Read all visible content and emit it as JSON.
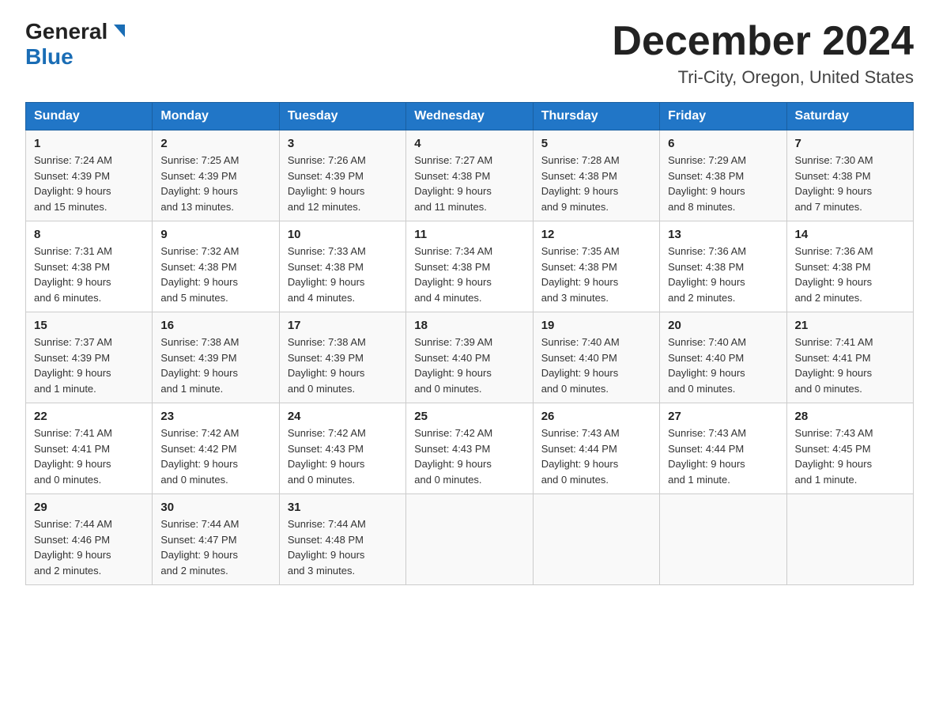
{
  "header": {
    "logo_general": "General",
    "logo_blue": "Blue",
    "month_title": "December 2024",
    "location": "Tri-City, Oregon, United States"
  },
  "days_of_week": [
    "Sunday",
    "Monday",
    "Tuesday",
    "Wednesday",
    "Thursday",
    "Friday",
    "Saturday"
  ],
  "weeks": [
    [
      {
        "day": "1",
        "sunrise": "7:24 AM",
        "sunset": "4:39 PM",
        "daylight": "9 hours and 15 minutes."
      },
      {
        "day": "2",
        "sunrise": "7:25 AM",
        "sunset": "4:39 PM",
        "daylight": "9 hours and 13 minutes."
      },
      {
        "day": "3",
        "sunrise": "7:26 AM",
        "sunset": "4:39 PM",
        "daylight": "9 hours and 12 minutes."
      },
      {
        "day": "4",
        "sunrise": "7:27 AM",
        "sunset": "4:38 PM",
        "daylight": "9 hours and 11 minutes."
      },
      {
        "day": "5",
        "sunrise": "7:28 AM",
        "sunset": "4:38 PM",
        "daylight": "9 hours and 9 minutes."
      },
      {
        "day": "6",
        "sunrise": "7:29 AM",
        "sunset": "4:38 PM",
        "daylight": "9 hours and 8 minutes."
      },
      {
        "day": "7",
        "sunrise": "7:30 AM",
        "sunset": "4:38 PM",
        "daylight": "9 hours and 7 minutes."
      }
    ],
    [
      {
        "day": "8",
        "sunrise": "7:31 AM",
        "sunset": "4:38 PM",
        "daylight": "9 hours and 6 minutes."
      },
      {
        "day": "9",
        "sunrise": "7:32 AM",
        "sunset": "4:38 PM",
        "daylight": "9 hours and 5 minutes."
      },
      {
        "day": "10",
        "sunrise": "7:33 AM",
        "sunset": "4:38 PM",
        "daylight": "9 hours and 4 minutes."
      },
      {
        "day": "11",
        "sunrise": "7:34 AM",
        "sunset": "4:38 PM",
        "daylight": "9 hours and 4 minutes."
      },
      {
        "day": "12",
        "sunrise": "7:35 AM",
        "sunset": "4:38 PM",
        "daylight": "9 hours and 3 minutes."
      },
      {
        "day": "13",
        "sunrise": "7:36 AM",
        "sunset": "4:38 PM",
        "daylight": "9 hours and 2 minutes."
      },
      {
        "day": "14",
        "sunrise": "7:36 AM",
        "sunset": "4:38 PM",
        "daylight": "9 hours and 2 minutes."
      }
    ],
    [
      {
        "day": "15",
        "sunrise": "7:37 AM",
        "sunset": "4:39 PM",
        "daylight": "9 hours and 1 minute."
      },
      {
        "day": "16",
        "sunrise": "7:38 AM",
        "sunset": "4:39 PM",
        "daylight": "9 hours and 1 minute."
      },
      {
        "day": "17",
        "sunrise": "7:38 AM",
        "sunset": "4:39 PM",
        "daylight": "9 hours and 0 minutes."
      },
      {
        "day": "18",
        "sunrise": "7:39 AM",
        "sunset": "4:40 PM",
        "daylight": "9 hours and 0 minutes."
      },
      {
        "day": "19",
        "sunrise": "7:40 AM",
        "sunset": "4:40 PM",
        "daylight": "9 hours and 0 minutes."
      },
      {
        "day": "20",
        "sunrise": "7:40 AM",
        "sunset": "4:40 PM",
        "daylight": "9 hours and 0 minutes."
      },
      {
        "day": "21",
        "sunrise": "7:41 AM",
        "sunset": "4:41 PM",
        "daylight": "9 hours and 0 minutes."
      }
    ],
    [
      {
        "day": "22",
        "sunrise": "7:41 AM",
        "sunset": "4:41 PM",
        "daylight": "9 hours and 0 minutes."
      },
      {
        "day": "23",
        "sunrise": "7:42 AM",
        "sunset": "4:42 PM",
        "daylight": "9 hours and 0 minutes."
      },
      {
        "day": "24",
        "sunrise": "7:42 AM",
        "sunset": "4:43 PM",
        "daylight": "9 hours and 0 minutes."
      },
      {
        "day": "25",
        "sunrise": "7:42 AM",
        "sunset": "4:43 PM",
        "daylight": "9 hours and 0 minutes."
      },
      {
        "day": "26",
        "sunrise": "7:43 AM",
        "sunset": "4:44 PM",
        "daylight": "9 hours and 0 minutes."
      },
      {
        "day": "27",
        "sunrise": "7:43 AM",
        "sunset": "4:44 PM",
        "daylight": "9 hours and 1 minute."
      },
      {
        "day": "28",
        "sunrise": "7:43 AM",
        "sunset": "4:45 PM",
        "daylight": "9 hours and 1 minute."
      }
    ],
    [
      {
        "day": "29",
        "sunrise": "7:44 AM",
        "sunset": "4:46 PM",
        "daylight": "9 hours and 2 minutes."
      },
      {
        "day": "30",
        "sunrise": "7:44 AM",
        "sunset": "4:47 PM",
        "daylight": "9 hours and 2 minutes."
      },
      {
        "day": "31",
        "sunrise": "7:44 AM",
        "sunset": "4:48 PM",
        "daylight": "9 hours and 3 minutes."
      },
      null,
      null,
      null,
      null
    ]
  ],
  "labels": {
    "sunrise": "Sunrise:",
    "sunset": "Sunset:",
    "daylight": "Daylight:"
  }
}
